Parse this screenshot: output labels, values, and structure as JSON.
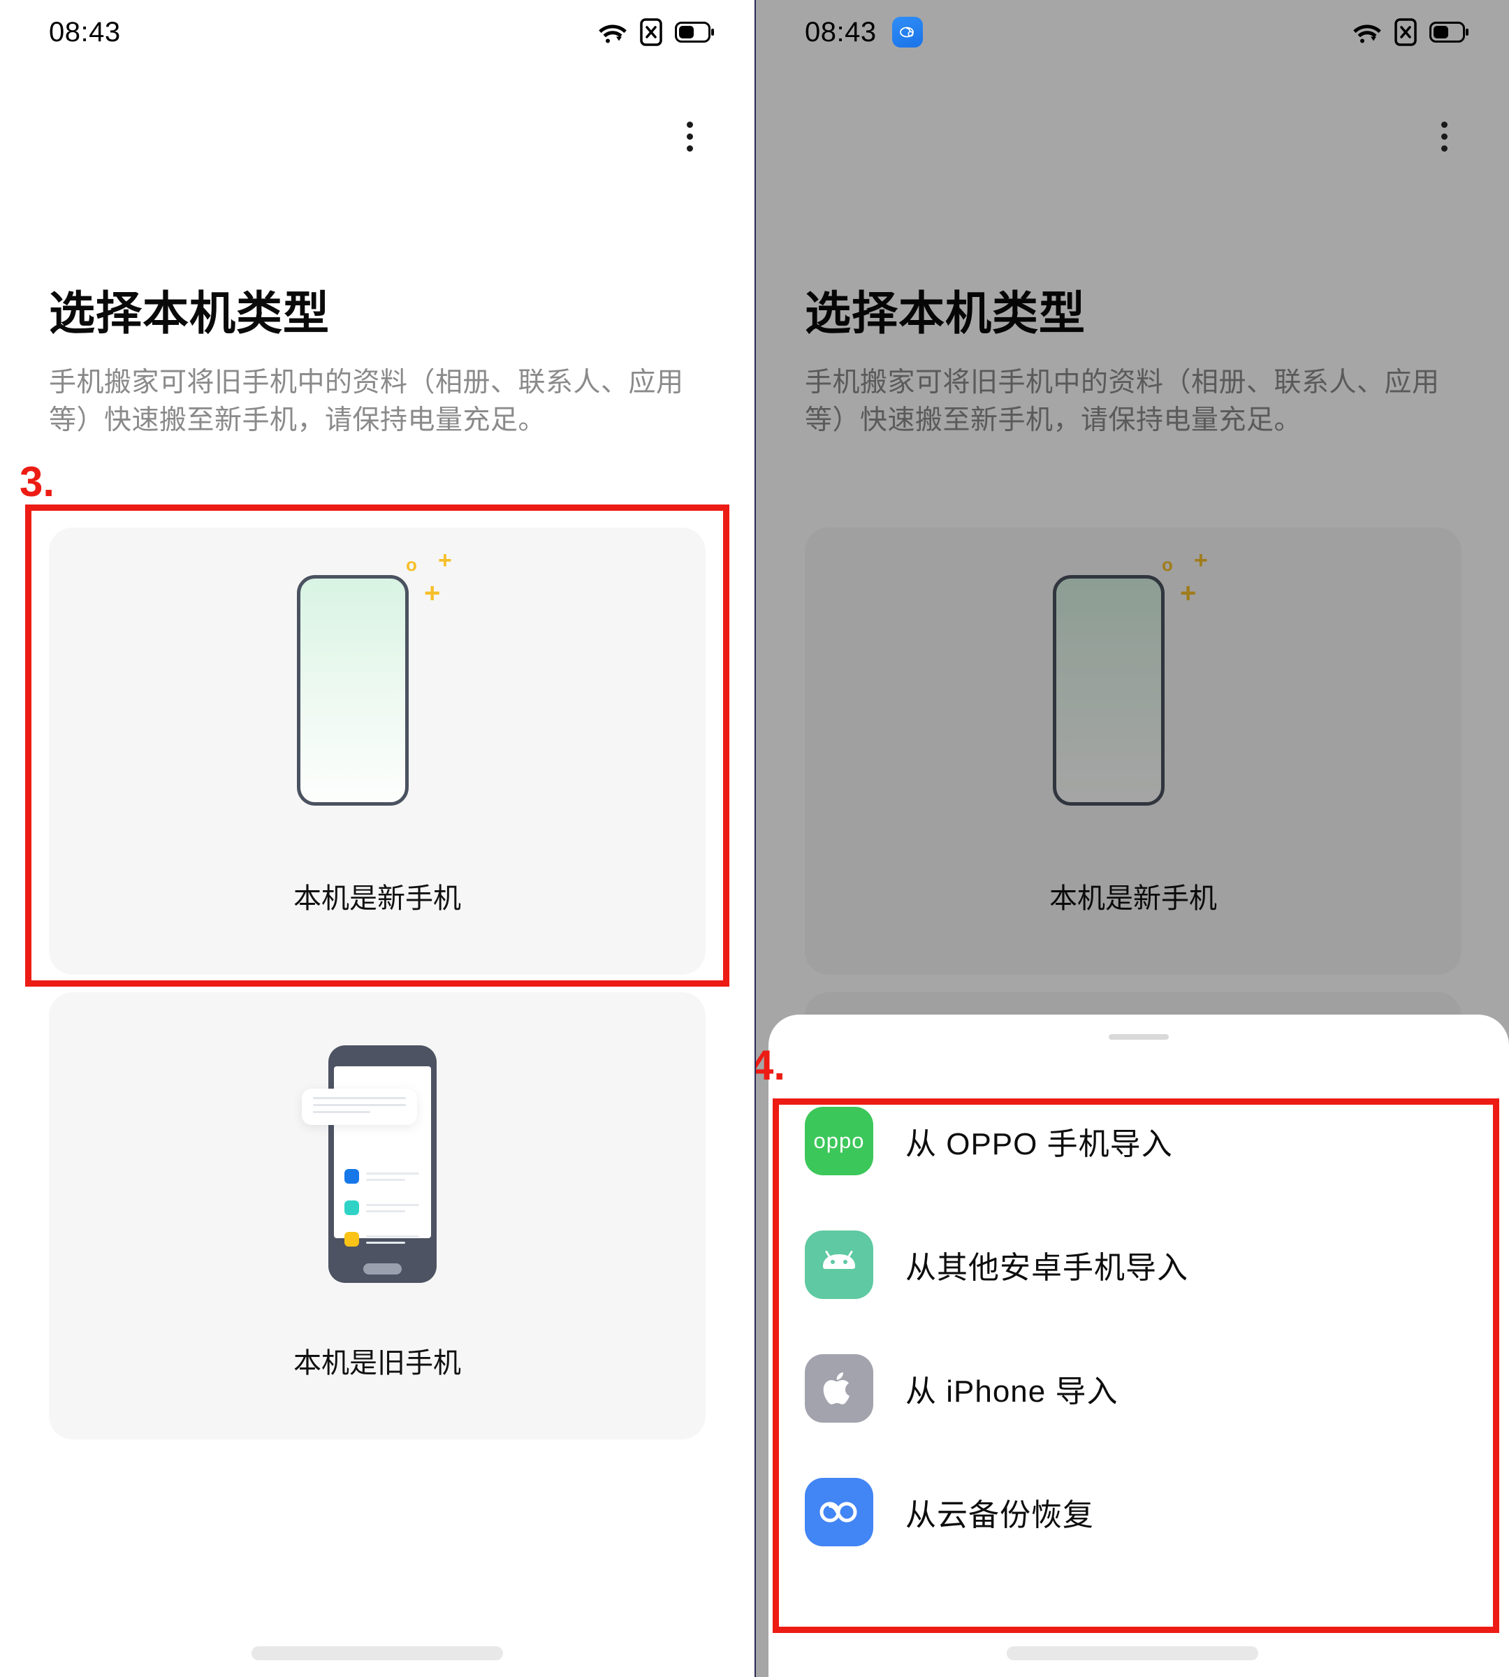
{
  "left_panel": {
    "statusbar": {
      "time": "08:43",
      "wifi_icon": "wifi-icon",
      "nosim_icon": "no-sim-icon",
      "battery_icon": "battery-icon"
    },
    "overflow_menu": "more-options-icon",
    "title": "选择本机类型",
    "description": "手机搬家可将旧手机中的资料（相册、联系人、应用等）快速搬至新手机，请保持电量充足。",
    "cards": [
      {
        "label": "本机是新手机",
        "illustration": "new-phone-illustration"
      },
      {
        "label": "本机是旧手机",
        "illustration": "old-phone-illustration"
      }
    ],
    "annotation": {
      "number": "3."
    }
  },
  "right_panel": {
    "statusbar": {
      "time": "08:43",
      "app_icon": "phone-clone-app-icon",
      "wifi_icon": "wifi-icon",
      "nosim_icon": "no-sim-icon",
      "battery_icon": "battery-icon"
    },
    "overflow_menu": "more-options-icon",
    "title": "选择本机类型",
    "description": "手机搬家可将旧手机中的资料（相册、联系人、应用等）快速搬至新手机，请保持电量充足。",
    "cards": [
      {
        "label": "本机是新手机",
        "illustration": "new-phone-illustration"
      }
    ],
    "annotation": {
      "number": "4."
    },
    "sheet": {
      "handle": "drag-handle",
      "options": [
        {
          "label": "从 OPPO 手机导入",
          "icon": "oppo-logo-icon",
          "icon_text": "oppo",
          "color": "#3cc75a"
        },
        {
          "label": "从其他安卓手机导入",
          "icon": "android-robot-icon",
          "icon_text": "",
          "color": "#5ec9a2"
        },
        {
          "label": "从 iPhone 导入",
          "icon": "apple-logo-icon",
          "icon_text": "",
          "color": "#a3a3ae"
        },
        {
          "label": "从云备份恢复",
          "icon": "cloud-backup-icon",
          "icon_text": "",
          "color": "#4285f4"
        }
      ]
    }
  },
  "colors": {
    "annotation_red": "#ec1c15",
    "card_bg": "#f6f6f6",
    "title_text": "#0a0a0a",
    "desc_text": "#8a8a8a",
    "new_phone_gradient_start": "#d8f3e3",
    "sparkle_yellow": "#f6bf2a",
    "old_phone_body": "#4d5362",
    "list_square_blue": "#1677e8",
    "list_square_teal": "#2ed3c6",
    "list_square_yellow": "#fac315"
  }
}
